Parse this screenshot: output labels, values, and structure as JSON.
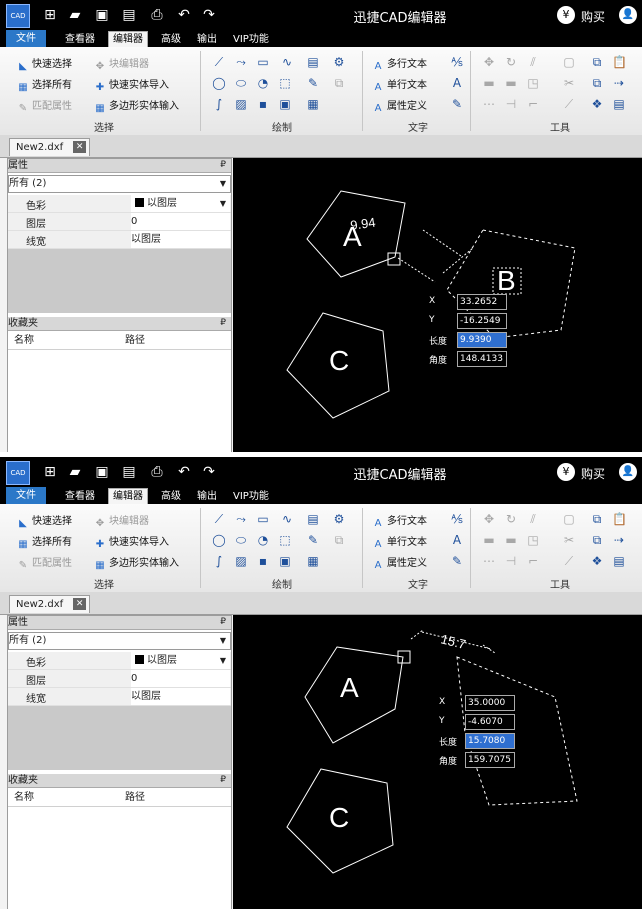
{
  "app": {
    "logo_text": "CAD",
    "title": "迅捷CAD编辑器",
    "buy_icon": "¥",
    "buy_label": "购买",
    "user_icon": "user-icon"
  },
  "menu": [
    "文件",
    "查看器",
    "编辑器",
    "高级",
    "输出",
    "VIP功能"
  ],
  "ribbon": {
    "select_group": {
      "label": "选择",
      "items": [
        "快速选择",
        "选择所有",
        "匹配属性",
        "块编辑器",
        "快速实体导入",
        "多边形实体输入"
      ]
    },
    "draw_group": {
      "label": "绘制"
    },
    "text_group": {
      "label": "文字",
      "items": [
        "多行文本",
        "单行文本",
        "属性定义"
      ]
    },
    "tools_group": {
      "label": "工具"
    }
  },
  "document_tab": "New2.dxf",
  "properties_panel": {
    "title": "属性",
    "pin": "₽",
    "selection": "所有 (2)",
    "rows": [
      {
        "name": "色彩",
        "value": "以图层"
      },
      {
        "name": "图层",
        "value": "0"
      },
      {
        "name": "线宽",
        "value": "以图层"
      }
    ]
  },
  "favorites_panel": {
    "title": "收藏夹",
    "pin": "₽",
    "columns": [
      "名称",
      "路径"
    ]
  },
  "drawing": {
    "shape_labels": [
      "A",
      "B",
      "C"
    ],
    "dynamic_labels": [
      "X",
      "Y",
      "长度",
      "角度"
    ]
  },
  "screenshots": [
    {
      "dimension_text": "9.94",
      "dynamic_input": {
        "x": "33.2652",
        "y": "-16.2549",
        "length": "9.9390",
        "angle": "148.4133"
      }
    },
    {
      "dimension_text": "15.7",
      "dynamic_input": {
        "x": "35.0000",
        "y": "-4.6070",
        "length": "15.7080",
        "angle": "159.7075"
      }
    }
  ]
}
